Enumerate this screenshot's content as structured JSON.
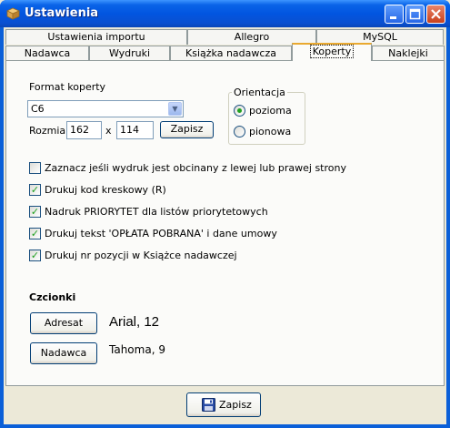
{
  "window": {
    "title": "Ustawienia"
  },
  "tabs": {
    "row1": [
      {
        "label": "Ustawienia importu"
      },
      {
        "label": "Allegro"
      },
      {
        "label": "MySQL"
      }
    ],
    "row2": [
      {
        "label": "Nadawca"
      },
      {
        "label": "Wydruki"
      },
      {
        "label": "Książka nadawcza"
      },
      {
        "label": "Koperty",
        "selected": true
      },
      {
        "label": "Naklejki"
      }
    ]
  },
  "envelope": {
    "format_label": "Format koperty",
    "format_value": "C6",
    "size_label": "Rozmiar",
    "width": "162",
    "x_sep": "x",
    "height": "114",
    "save_label": "Zapisz"
  },
  "orientation": {
    "title": "Orientacja",
    "options": [
      {
        "label": "pozioma",
        "checked": true
      },
      {
        "label": "pionowa",
        "checked": false
      }
    ]
  },
  "options": [
    {
      "label": "Zaznacz jeśli wydruk jest obcinany z lewej lub prawej strony",
      "checked": false
    },
    {
      "label": "Drukuj kod kreskowy (R)",
      "checked": true
    },
    {
      "label": "Nadruk PRIORYTET dla listów priorytetowych",
      "checked": true
    },
    {
      "label": "Drukuj tekst 'OPŁATA POBRANA' i dane umowy",
      "checked": true
    },
    {
      "label": "Drukuj nr pozycji w Książce nadawczej",
      "checked": true
    }
  ],
  "fonts": {
    "title": "Czcionki",
    "adresat_label": "Adresat",
    "adresat_font": "Arial, 12",
    "nadawca_label": "Nadawca",
    "nadawca_font": "Tahoma, 9"
  },
  "footer": {
    "save_label": "Zapisz"
  },
  "icons": {
    "app": "package-icon",
    "save": "floppy-disk-icon"
  }
}
